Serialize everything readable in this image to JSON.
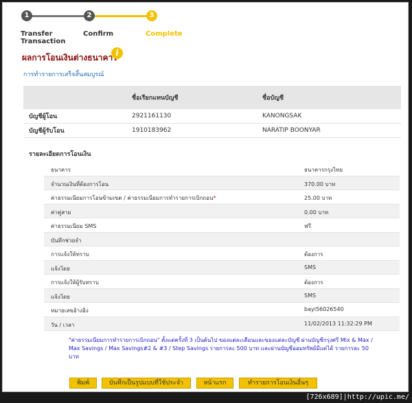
{
  "steps": [
    {
      "number": "1",
      "label_line1": "Transfer",
      "label_line2": "Transaction"
    },
    {
      "number": "2",
      "label_line1": "Confirm",
      "label_line2": ""
    },
    {
      "number": "3",
      "label_line1": "Complete",
      "label_line2": ""
    }
  ],
  "colors": {
    "step_done": "#555555",
    "step_active": "#f2c200",
    "title": "#8b0e0e",
    "link": "#2a6fb8",
    "button": "#f2c200",
    "note": "#1a1acc"
  },
  "page": {
    "title": "ผลการโอนเงินต่างธนาคาร",
    "info_icon": "i",
    "success_message": "การทำรายการเสร็จสิ้นสมบูรณ์"
  },
  "account_table": {
    "headers": [
      "",
      "ชื่อเรียกแทนบัญชี",
      "ชื่อบัญชี"
    ],
    "rows": [
      {
        "label": "บัญชีผู้โอน",
        "number": "2921161130",
        "name": "KANONGSAK"
      },
      {
        "label": "บัญชีผู้รับโอน",
        "number": "1910183962",
        "name": "NARATIP BOONYAR"
      }
    ]
  },
  "details": {
    "title": "รายละเอียดการโอนเงิน",
    "rows": [
      {
        "label": "ธนาคาร",
        "value": "ธนาคารกรุงไทย",
        "star": ""
      },
      {
        "label": "จำนวนเงินที่ต้องการโอน",
        "value": "370.00 บาท",
        "star": ""
      },
      {
        "label": "ค่าธรรมเนียมการโอนข้ามเขต / ค่าธรรมเนียมการทำรายการเบิกถอน",
        "value": "25.00 บาท",
        "star": "*"
      },
      {
        "label": "ค่าคู่สาย",
        "value": "0.00 บาท",
        "star": ""
      },
      {
        "label": "ค่าธรรมเนียม SMS",
        "value": "ฟรี",
        "star": ""
      },
      {
        "label": "บันทึกช่วยจำ",
        "value": "",
        "star": ""
      },
      {
        "label": "การแจ้งให้ทราบ",
        "value": "ต้องการ",
        "star": ""
      },
      {
        "label": "แจ้งโดย",
        "value": "SMS",
        "star": ""
      },
      {
        "label": "การแจ้งให้ผู้รับทราบ",
        "value": "ต้องการ",
        "star": ""
      },
      {
        "label": "แจ้งโดย",
        "value": "SMS",
        "star": ""
      },
      {
        "label": "หมายเลขอ้างอิง",
        "value": "bayi56026540",
        "star": ""
      },
      {
        "label": "วัน / เวลา",
        "value": "11/02/2013 11:32:29 PM",
        "star": ""
      }
    ]
  },
  "note": "\"ค่าธรรมเนียมการทำรายการเบิกถอน\" ตั้งแต่ครั้งที่ 3 เป็นต้นไป ของแต่ละเดือนและของแต่ละบัญชี ผ่านบัญชีกรุงศรี Mix & Max / Max Savings / Max Savings#2 & #3 / Step Savings รายการละ 500 บาท และผ่านบัญชีออมทรัพย์มีแต่ได้ รายการละ 50 บาท",
  "buttons": {
    "print": "พิมพ์",
    "save_template": "บันทึกเป็นรูปแบบที่ใช้ประจำ",
    "home": "หน้าแรก",
    "other": "ทำรายการโอนเงินอื่นๆ"
  },
  "footer_tag": "[726x689]|http://upic.me/"
}
